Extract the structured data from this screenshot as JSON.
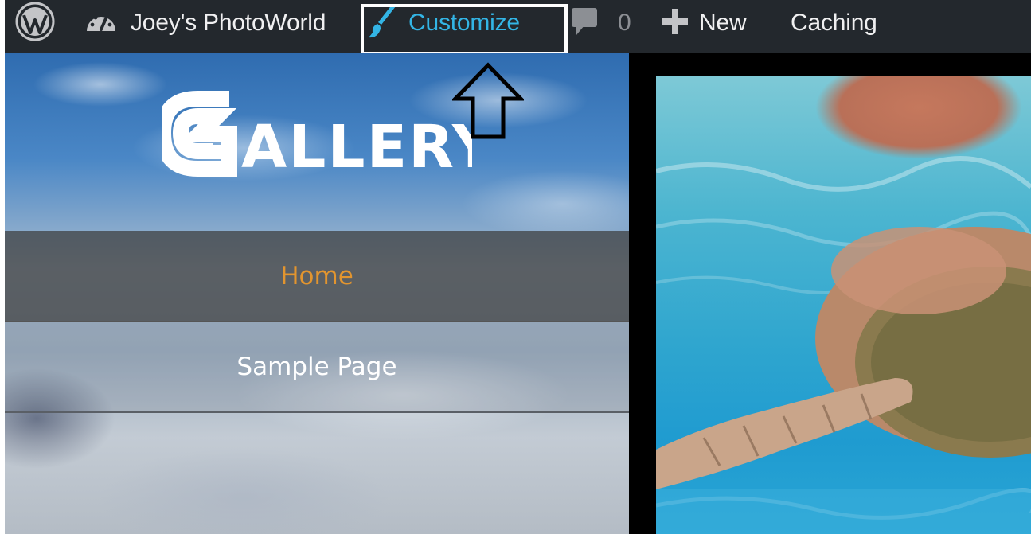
{
  "adminbar": {
    "site_name": "Joey's PhotoWorld",
    "customize_label": "Customize",
    "comments_count": "0",
    "new_label": "New",
    "caching_label": "Caching"
  },
  "icons": {
    "wordpress": "wordpress-logo-icon",
    "dashboard": "dashboard-gauge-icon",
    "customize": "paintbrush-icon",
    "comments": "speech-bubble-icon",
    "new": "plus-icon",
    "annotation": "up-arrow-icon"
  },
  "site": {
    "logo_text": "ALLERY"
  },
  "nav": {
    "items": [
      {
        "label": "Home",
        "active": true
      },
      {
        "label": "Sample Page",
        "active": false
      }
    ]
  },
  "colors": {
    "adminbar_bg": "#23282d",
    "customize_accent": "#33b5e5",
    "nav_active": "#e2952f"
  }
}
